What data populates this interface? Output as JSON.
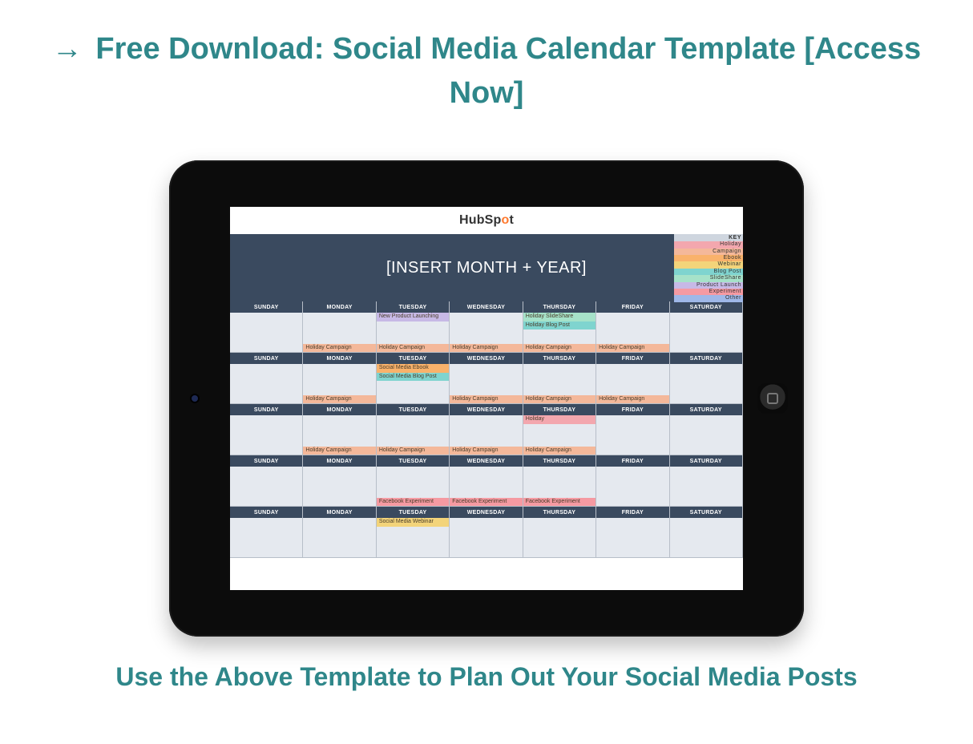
{
  "link": {
    "arrow": "→",
    "text": "Free Download: Social Media Calendar Template [Access Now]"
  },
  "subhead": "Use the Above Template to Plan Out Your Social Media Posts",
  "brand": {
    "pre": "HubSp",
    "mid": "o",
    "post": "t"
  },
  "month_placeholder": "[INSERT MONTH + YEAR]",
  "key": {
    "heading": "KEY",
    "items": [
      "Holiday",
      "Campaign",
      "Ebook",
      "Webinar",
      "Blog Post",
      "SlideShare",
      "Product Launch",
      "Experiment",
      "Other"
    ]
  },
  "days": [
    "SUNDAY",
    "MONDAY",
    "TUESDAY",
    "WEDNESDAY",
    "THURSDAY",
    "FRIDAY",
    "SATURDAY"
  ],
  "weeks": [
    {
      "cells": [
        [],
        [
          {
            "t": "gap"
          },
          {
            "t": "pill",
            "cls": "c-peach",
            "label": "Holiday Campaign"
          }
        ],
        [
          {
            "t": "pill",
            "cls": "c-lav",
            "label": "New Product Launching"
          },
          {
            "t": "gap"
          },
          {
            "t": "pill",
            "cls": "c-peach",
            "label": "Holiday Campaign"
          }
        ],
        [
          {
            "t": "gap"
          },
          {
            "t": "pill",
            "cls": "c-peach",
            "label": "Holiday Campaign"
          }
        ],
        [
          {
            "t": "pill",
            "cls": "c-mint",
            "label": "Holiday SlideShare"
          },
          {
            "t": "pill",
            "cls": "c-teal",
            "label": "Holiday Blog Post"
          },
          {
            "t": "gap"
          },
          {
            "t": "pill",
            "cls": "c-peach",
            "label": "Holiday Campaign"
          }
        ],
        [
          {
            "t": "gap"
          },
          {
            "t": "pill",
            "cls": "c-peach",
            "label": "Holiday Campaign"
          }
        ],
        []
      ]
    },
    {
      "cells": [
        [],
        [
          {
            "t": "gap"
          },
          {
            "t": "pill",
            "cls": "c-peach",
            "label": "Holiday Campaign"
          }
        ],
        [
          {
            "t": "pill",
            "cls": "c-orange",
            "label": "Social Media Ebook"
          },
          {
            "t": "pill",
            "cls": "c-teal",
            "label": "Social Media Blog Post"
          },
          {
            "t": "gap"
          }
        ],
        [
          {
            "t": "gap"
          },
          {
            "t": "pill",
            "cls": "c-peach",
            "label": "Holiday Campaign"
          }
        ],
        [
          {
            "t": "gap"
          },
          {
            "t": "pill",
            "cls": "c-peach",
            "label": "Holiday Campaign"
          }
        ],
        [
          {
            "t": "gap"
          },
          {
            "t": "pill",
            "cls": "c-peach",
            "label": "Holiday Campaign"
          }
        ],
        []
      ]
    },
    {
      "cells": [
        [],
        [
          {
            "t": "gap"
          },
          {
            "t": "pill",
            "cls": "c-peach",
            "label": "Holiday Campaign"
          }
        ],
        [
          {
            "t": "gap"
          },
          {
            "t": "pill",
            "cls": "c-peach",
            "label": "Holiday Campaign"
          }
        ],
        [
          {
            "t": "gap"
          },
          {
            "t": "pill",
            "cls": "c-peach",
            "label": "Holiday Campaign"
          }
        ],
        [
          {
            "t": "pill",
            "cls": "c-pink",
            "label": "Holiday"
          },
          {
            "t": "gap"
          },
          {
            "t": "pill",
            "cls": "c-peach",
            "label": "Holiday Campaign"
          }
        ],
        [],
        []
      ]
    },
    {
      "cells": [
        [],
        [],
        [
          {
            "t": "gap"
          },
          {
            "t": "pill",
            "cls": "c-rose",
            "label": "Facebook Experiment"
          }
        ],
        [
          {
            "t": "gap"
          },
          {
            "t": "pill",
            "cls": "c-rose",
            "label": "Facebook Experiment"
          }
        ],
        [
          {
            "t": "gap"
          },
          {
            "t": "pill",
            "cls": "c-rose",
            "label": "Facebook Experiment"
          }
        ],
        [],
        []
      ]
    },
    {
      "cells": [
        [],
        [],
        [
          {
            "t": "pill",
            "cls": "c-yellow",
            "label": "Social Media Webinar"
          },
          {
            "t": "gap"
          }
        ],
        [],
        [],
        [],
        []
      ]
    }
  ],
  "key_colors": [
    "c-pink",
    "c-peach",
    "c-orange",
    "c-yellow",
    "c-teal",
    "c-mint",
    "c-lav",
    "c-rose",
    "c-blue"
  ]
}
